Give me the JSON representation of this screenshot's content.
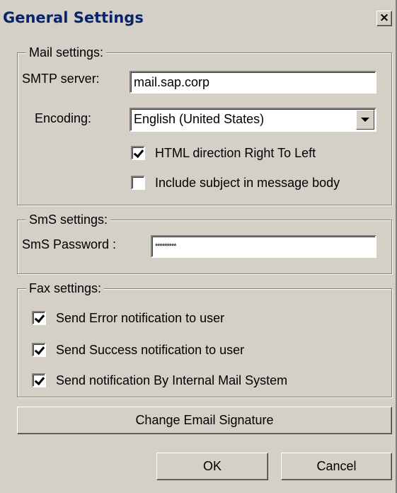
{
  "window": {
    "title": "General Settings",
    "close_label": "×"
  },
  "mail": {
    "legend": "Mail settings:",
    "smtp_label": "SMTP server:",
    "smtp_value": "mail.sap.corp",
    "encoding_label": "Encoding:",
    "encoding_value": "English (United States)",
    "rtl_label": "HTML direction Right To Left",
    "rtl_checked": true,
    "subject_label": "Include subject in message body",
    "subject_checked": false
  },
  "sms": {
    "legend": "SmS settings:",
    "password_label": "SmS Password :",
    "password_value": "*********"
  },
  "fax": {
    "legend": "Fax settings:",
    "error_label": "Send Error notification to user",
    "error_checked": true,
    "success_label": "Send Success notification to user",
    "success_checked": true,
    "internal_label": "Send notification By Internal Mail System",
    "internal_checked": true
  },
  "buttons": {
    "signature_label": "Change Email Signature",
    "ok_label": "OK",
    "cancel_label": "Cancel"
  }
}
